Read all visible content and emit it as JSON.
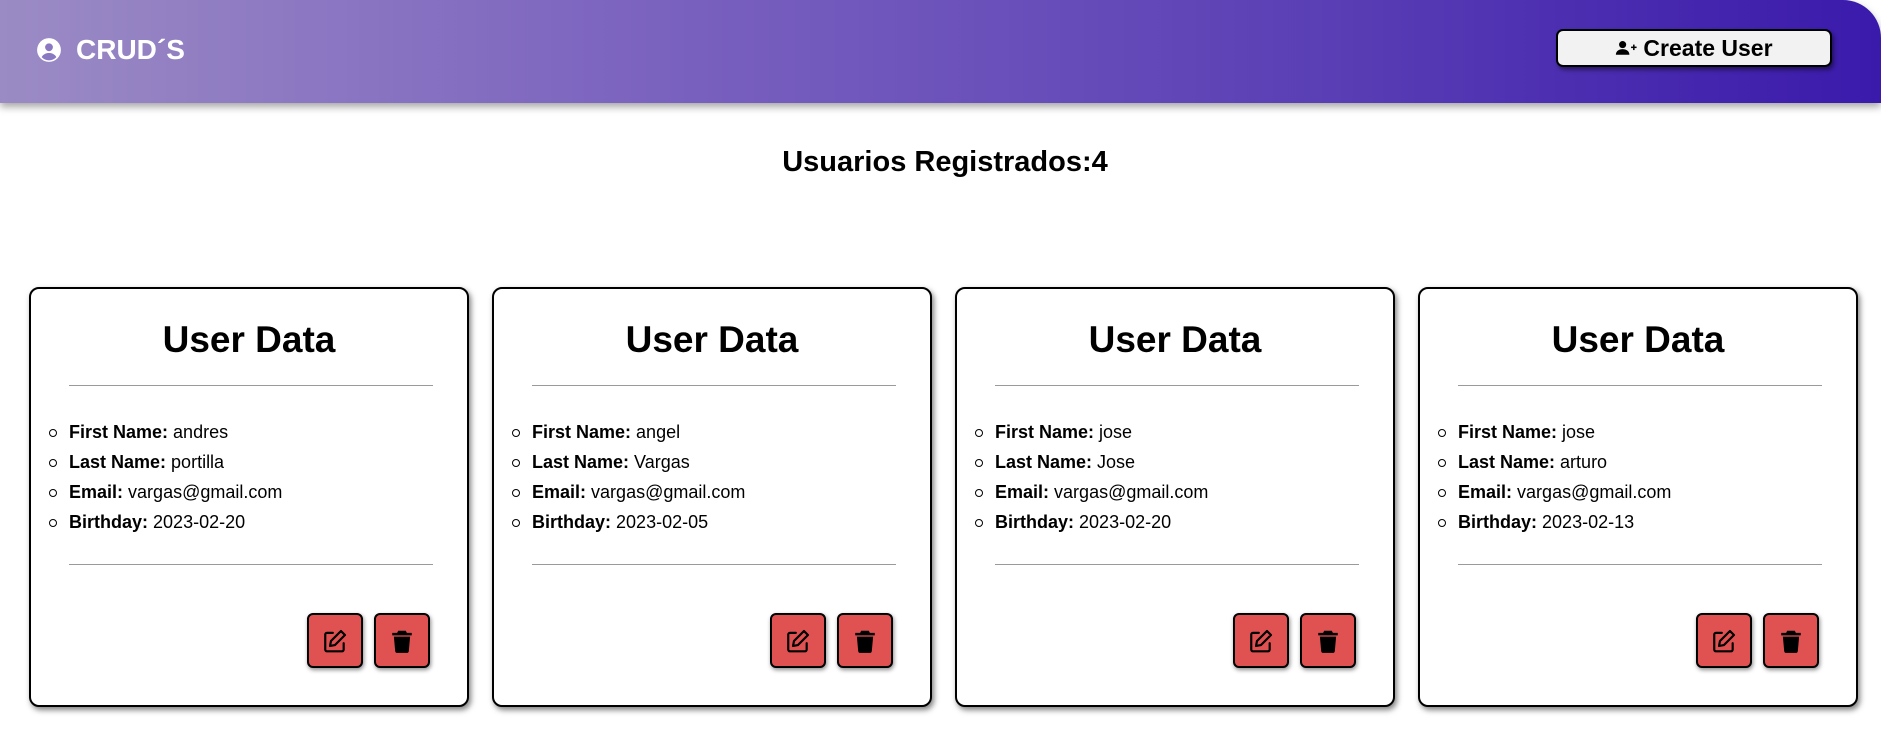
{
  "header": {
    "brand": "CRUD´S",
    "brand_icon": "user-circle-icon",
    "create_button": "Create User",
    "create_icon": "user-plus-icon"
  },
  "summary": {
    "title": "Usuarios Registrados:4"
  },
  "labels": {
    "first_name": "First Name:",
    "last_name": "Last Name:",
    "email": "Email:",
    "birthday": "Birthday:"
  },
  "cards": [
    {
      "title": "User Data",
      "first_name": "andres",
      "last_name": "portilla",
      "email": "vargas@gmail.com",
      "birthday": "2023-02-20"
    },
    {
      "title": "User Data",
      "first_name": "angel",
      "last_name": "Vargas",
      "email": "vargas@gmail.com",
      "birthday": "2023-02-05"
    },
    {
      "title": "User Data",
      "first_name": "jose",
      "last_name": "Jose",
      "email": "vargas@gmail.com",
      "birthday": "2023-02-20"
    },
    {
      "title": "User Data",
      "first_name": "jose",
      "last_name": "arturo",
      "email": "vargas@gmail.com",
      "birthday": "2023-02-13"
    }
  ],
  "colors": {
    "action_button": "#e05252",
    "header_start": "#9b8bc4",
    "header_end": "#3a1aab"
  },
  "icons": {
    "edit": "edit-icon",
    "delete": "trash-icon"
  }
}
